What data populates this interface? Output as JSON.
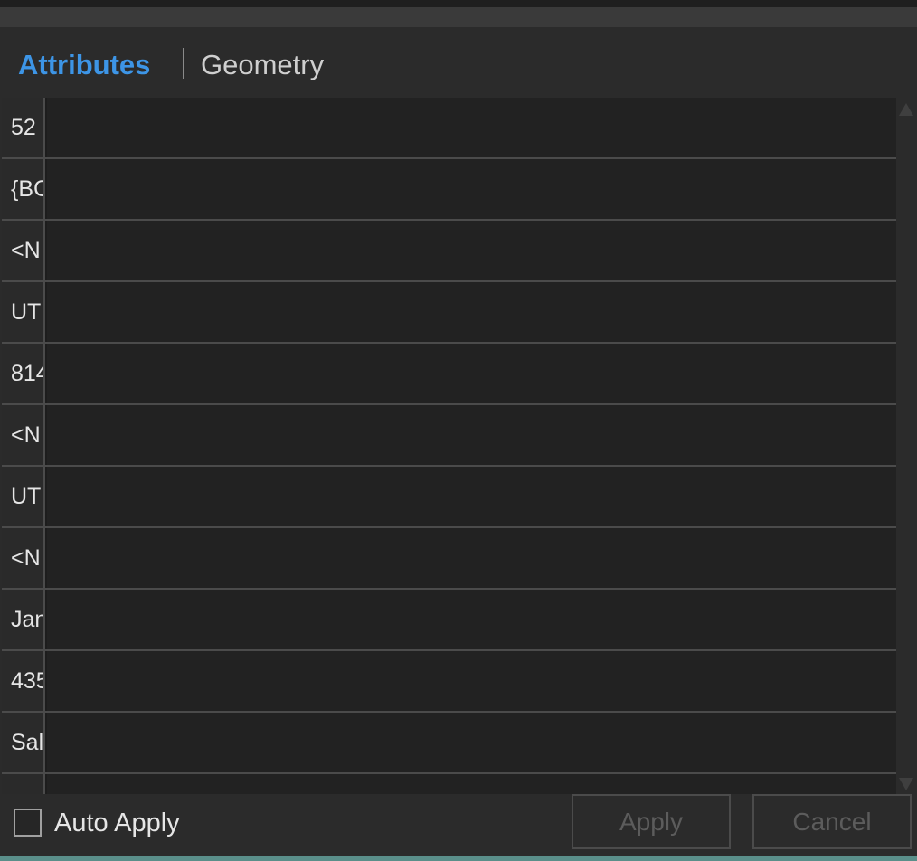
{
  "tabs": {
    "attributes": "Attributes",
    "geometry": "Geometry"
  },
  "grid": {
    "rows": [
      {
        "label": "52",
        "value": ""
      },
      {
        "label": "{BC",
        "value": ""
      },
      {
        "label": "<N",
        "value": ""
      },
      {
        "label": "UT",
        "value": ""
      },
      {
        "label": "814",
        "value": ""
      },
      {
        "label": "<N",
        "value": ""
      },
      {
        "label": "UT",
        "value": ""
      },
      {
        "label": "<N",
        "value": ""
      },
      {
        "label": "Jan",
        "value": ""
      },
      {
        "label": "435",
        "value": ""
      },
      {
        "label": "Sal",
        "value": ""
      },
      {
        "label": "",
        "value": ""
      }
    ]
  },
  "footer": {
    "auto_apply_label": "Auto Apply",
    "auto_apply_checked": false,
    "apply_label": "Apply",
    "cancel_label": "Cancel"
  },
  "colors": {
    "accent": "#3d95e6",
    "background": "#2b2b2b",
    "grid_background": "#1d1d1d",
    "disabled_text": "#5c5c5c"
  }
}
